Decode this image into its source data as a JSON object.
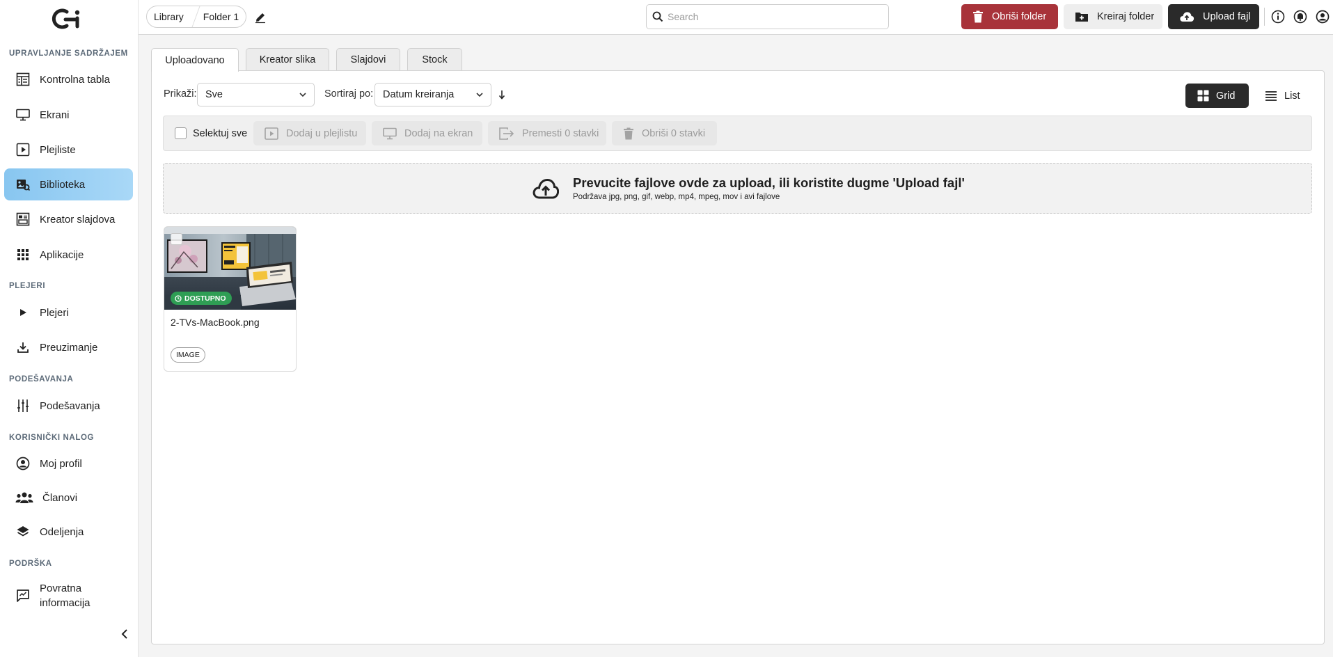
{
  "sidebar": {
    "sections": {
      "content": "UPRAVLJANJE SADRŽAJEM",
      "players": "PLEJERI",
      "settings": "PODEŠAVANJA",
      "account": "KORISNIČKI NALOG",
      "support": "PODRŠKA"
    },
    "items": {
      "dashboard": "Kontrolna tabla",
      "screens": "Ekrani",
      "playlists": "Plejliste",
      "library": "Biblioteka",
      "slide_creator": "Kreator slajdova",
      "apps": "Aplikacije",
      "players": "Plejeri",
      "downloads": "Preuzimanje",
      "settings": "Podešavanja",
      "profile": "Moj profil",
      "members": "Članovi",
      "departments": "Odeljenja",
      "feedback": "Povratna informacija"
    },
    "active_item": "library"
  },
  "topbar": {
    "breadcrumb": [
      "Library",
      "Folder 1"
    ],
    "search_placeholder": "Search",
    "delete_folder": "Obriši folder",
    "create_folder": "Kreiraj folder",
    "upload_file": "Upload fajl"
  },
  "tabs": [
    "Uploadovano",
    "Kreator slika",
    "Slajdovi",
    "Stock"
  ],
  "active_tab": 0,
  "filters": {
    "show_label": "Prikaži:",
    "show_value": "Sve",
    "sort_label": "Sortiraj po:",
    "sort_value": "Datum kreiranja"
  },
  "view": {
    "grid": "Grid",
    "list": "List",
    "selected": "grid"
  },
  "actions": {
    "select_all": "Selektuj sve",
    "add_playlist": "Dodaj u plejlistu",
    "add_screen": "Dodaj na ekran",
    "move": "Premesti 0 stavki",
    "delete": "Obriši 0 stavki"
  },
  "dropzone": {
    "title": "Prevucite fajlove ovde za upload, ili koristite dugme 'Upload fajl'",
    "subtitle": "Podržava jpg, png, gif, webp, mp4, mpeg, mov i avi fajlove"
  },
  "files": [
    {
      "name": "2-TVs-MacBook.png",
      "status": "DOSTUPNO",
      "type": "IMAGE"
    }
  ],
  "colors": {
    "active_nav": "#88c6f0",
    "danger": "#a8333a",
    "dark_button": "#2a2a2a",
    "status_available": "#2f9e54"
  }
}
